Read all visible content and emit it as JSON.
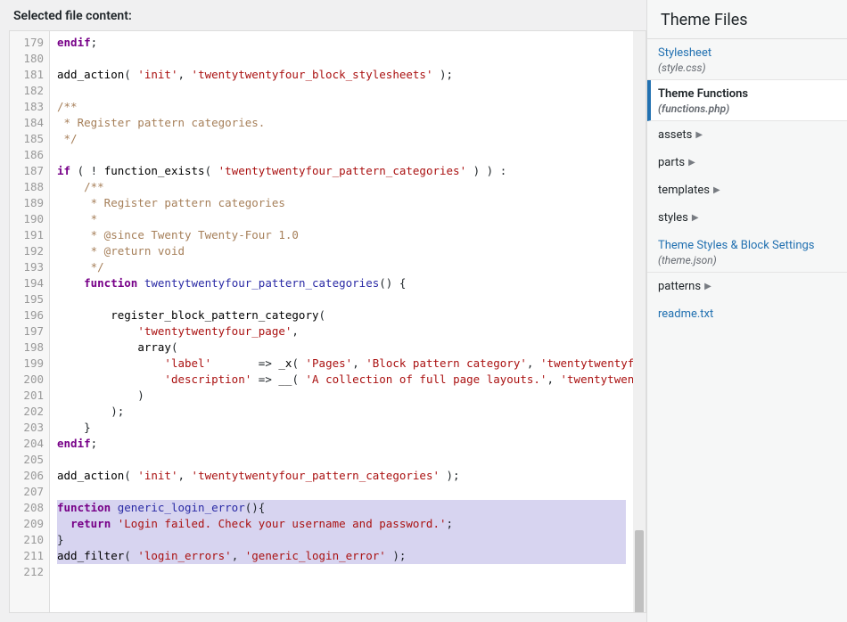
{
  "header": {
    "title": "Selected file content:"
  },
  "sidebar": {
    "title": "Theme Files",
    "items": [
      {
        "kind": "file",
        "name": "Stylesheet",
        "desc": "(style.css)",
        "active": false
      },
      {
        "kind": "file",
        "name": "Theme Functions",
        "desc": "(functions.php)",
        "active": true
      },
      {
        "kind": "folder",
        "name": "assets"
      },
      {
        "kind": "folder",
        "name": "parts"
      },
      {
        "kind": "folder",
        "name": "templates"
      },
      {
        "kind": "folder",
        "name": "styles"
      },
      {
        "kind": "file",
        "name": "Theme Styles & Block Settings",
        "desc": "(theme.json)",
        "active": false
      },
      {
        "kind": "folder",
        "name": "patterns"
      },
      {
        "kind": "link",
        "name": "readme.txt"
      }
    ]
  },
  "code": {
    "first_line": 179,
    "lines": [
      {
        "n": 179,
        "hl": false,
        "html": "<span class='tok-kw'>endif</span>;"
      },
      {
        "n": 180,
        "hl": false,
        "html": ""
      },
      {
        "n": 181,
        "hl": false,
        "html": "<span class='tok-fn2'>add_action</span>( <span class='tok-str'>'init'</span>, <span class='tok-str'>'twentytwentyfour_block_stylesheets'</span> );"
      },
      {
        "n": 182,
        "hl": false,
        "html": ""
      },
      {
        "n": 183,
        "hl": false,
        "html": "<span class='tok-cm'>/**</span>"
      },
      {
        "n": 184,
        "hl": false,
        "html": "<span class='tok-cm'> * Register pattern categories.</span>"
      },
      {
        "n": 185,
        "hl": false,
        "html": "<span class='tok-cm'> */</span>"
      },
      {
        "n": 186,
        "hl": false,
        "html": ""
      },
      {
        "n": 187,
        "hl": false,
        "html": "<span class='tok-kw'>if</span> ( ! <span class='tok-fn2'>function_exists</span>( <span class='tok-str'>'twentytwentyfour_pattern_categories'</span> ) ) :"
      },
      {
        "n": 188,
        "hl": false,
        "html": "    <span class='tok-cm'>/**</span>"
      },
      {
        "n": 189,
        "hl": false,
        "html": "    <span class='tok-cm'> * Register pattern categories</span>"
      },
      {
        "n": 190,
        "hl": false,
        "html": "    <span class='tok-cm'> *</span>"
      },
      {
        "n": 191,
        "hl": false,
        "html": "    <span class='tok-cm'> * @since Twenty Twenty-Four 1.0</span>"
      },
      {
        "n": 192,
        "hl": false,
        "html": "    <span class='tok-cm'> * @return void</span>"
      },
      {
        "n": 193,
        "hl": false,
        "html": "    <span class='tok-cm'> */</span>"
      },
      {
        "n": 194,
        "hl": false,
        "html": "    <span class='tok-kw'>function</span> <span class='tok-fn'>twentytwentyfour_pattern_categories</span>() {"
      },
      {
        "n": 195,
        "hl": false,
        "html": ""
      },
      {
        "n": 196,
        "hl": false,
        "html": "        <span class='tok-fn2'>register_block_pattern_category</span>("
      },
      {
        "n": 197,
        "hl": false,
        "html": "            <span class='tok-str'>'twentytwentyfour_page'</span>,"
      },
      {
        "n": 198,
        "hl": false,
        "html": "            <span class='tok-fn2'>array</span>("
      },
      {
        "n": 199,
        "hl": false,
        "html": "                <span class='tok-str'>'label'</span>       =&gt; <span class='tok-fn2'>_x</span>( <span class='tok-str'>'Pages'</span>, <span class='tok-str'>'Block pattern category'</span>, <span class='tok-str'>'twentytwentyfour'</span> ),"
      },
      {
        "n": 200,
        "hl": false,
        "html": "                <span class='tok-str'>'description'</span> =&gt; <span class='tok-fn2'>__</span>( <span class='tok-str'>'A collection of full page layouts.'</span>, <span class='tok-str'>'twentytwentyfour'</span> ),"
      },
      {
        "n": 201,
        "hl": false,
        "html": "            )"
      },
      {
        "n": 202,
        "hl": false,
        "html": "        );"
      },
      {
        "n": 203,
        "hl": false,
        "html": "    }"
      },
      {
        "n": 204,
        "hl": false,
        "html": "<span class='tok-kw'>endif</span>;"
      },
      {
        "n": 205,
        "hl": false,
        "html": ""
      },
      {
        "n": 206,
        "hl": false,
        "html": "<span class='tok-fn2'>add_action</span>( <span class='tok-str'>'init'</span>, <span class='tok-str'>'twentytwentyfour_pattern_categories'</span> );"
      },
      {
        "n": 207,
        "hl": false,
        "html": ""
      },
      {
        "n": 208,
        "hl": true,
        "html": "<span class='tok-kw'>function</span> <span class='tok-fn'>generic_login_error</span>(){"
      },
      {
        "n": 209,
        "hl": true,
        "html": "  <span class='tok-kw'>return</span> <span class='tok-str'>'Login failed. Check your username and password.'</span>;"
      },
      {
        "n": 210,
        "hl": true,
        "html": "}"
      },
      {
        "n": 211,
        "hl": true,
        "html": "<span class='tok-fn2'>add_filter</span>( <span class='tok-str'>'login_errors'</span>, <span class='tok-str'>'generic_login_error'</span> );"
      },
      {
        "n": 212,
        "hl": false,
        "html": ""
      }
    ]
  }
}
